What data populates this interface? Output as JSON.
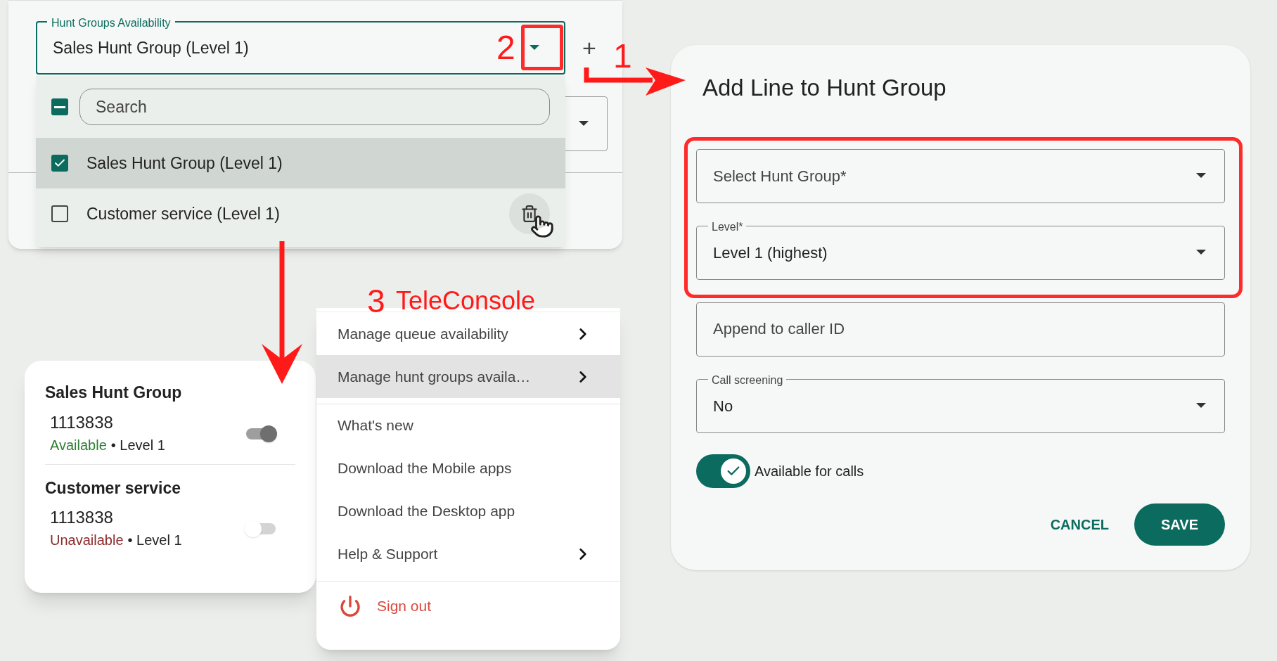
{
  "hunt_groups_panel": {
    "field": {
      "label": "Hunt Groups Availability",
      "value": "Sales Hunt Group (Level 1)"
    },
    "add_button": "+",
    "dropdown": {
      "select_all": {
        "indeterminate": true
      },
      "search": {
        "placeholder": "Search"
      },
      "items": [
        {
          "label": "Sales Hunt Group (Level 1)",
          "checked": true,
          "selected": true,
          "delete_visible": false
        },
        {
          "label": "Customer service (Level 1)",
          "checked": false,
          "selected": false,
          "delete_visible": true
        }
      ]
    }
  },
  "annotations": {
    "step_1": "1",
    "step_2": "2",
    "step_3": "3",
    "app_name": "TeleConsole"
  },
  "availability_card": {
    "groups": [
      {
        "name": "Sales Hunt Group",
        "number": "1113838",
        "status": "Available",
        "available": true,
        "level": "• Level 1"
      },
      {
        "name": "Customer service",
        "number": "1113838",
        "status": "Unavailable",
        "available": false,
        "level": "• Level 1"
      }
    ]
  },
  "menu": {
    "items": [
      {
        "label": "Manage queue availability",
        "submenu": true,
        "selected": false,
        "divider_after": false
      },
      {
        "label": "Manage hunt groups availa…",
        "submenu": true,
        "selected": true,
        "divider_after": true
      },
      {
        "label": "What's new",
        "submenu": false,
        "selected": false,
        "divider_after": false
      },
      {
        "label": "Download the Mobile apps",
        "submenu": false,
        "selected": false,
        "divider_after": false
      },
      {
        "label": "Download the Desktop app",
        "submenu": false,
        "selected": false,
        "divider_after": false
      },
      {
        "label": "Help & Support",
        "submenu": true,
        "selected": false,
        "divider_after": true
      }
    ],
    "sign_out": "Sign out"
  },
  "dialog": {
    "title": "Add Line to Hunt Group",
    "fields": [
      {
        "kind": "select",
        "label": "Select Hunt Group*"
      },
      {
        "kind": "select",
        "label": "Level*",
        "value": "Level 1 (highest)"
      },
      {
        "kind": "text",
        "placeholder": "Append to caller ID"
      },
      {
        "kind": "select",
        "label": "Call screening",
        "value": "No"
      }
    ],
    "toggle": {
      "label": "Available for calls",
      "on": true
    },
    "buttons": [
      {
        "label": "CANCEL",
        "kind": "text"
      },
      {
        "label": "SAVE",
        "kind": "filled"
      }
    ]
  }
}
